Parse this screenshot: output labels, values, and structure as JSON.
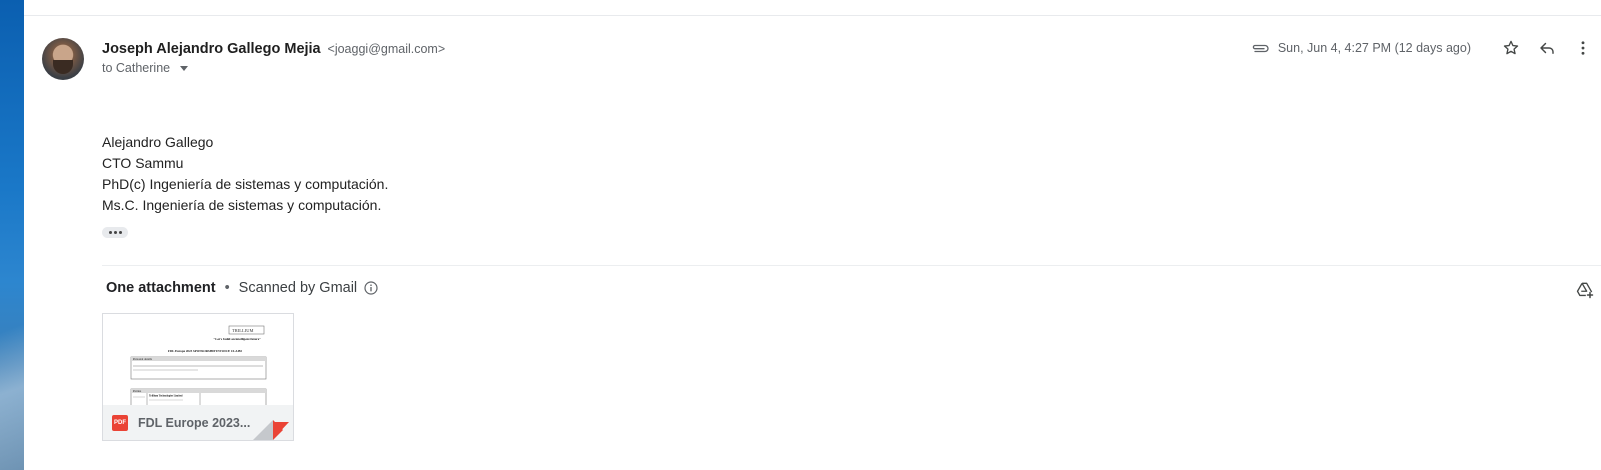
{
  "sender": {
    "name": "Joseph Alejandro Gallego Mejia",
    "email": "<joaggi@gmail.com>",
    "recipient": "to Catherine"
  },
  "meta": {
    "date": "Sun, Jun 4, 4:27 PM (12 days ago)"
  },
  "body_lines": [
    "Alejandro Gallego",
    "CTO Sammu",
    "PhD(c) Ingeniería de sistemas y computación.",
    "Ms.C. Ingeniería de sistemas y computación."
  ],
  "attachments": {
    "count_label": "One attachment",
    "separator": "•",
    "scanned_label": "Scanned by Gmail",
    "file": {
      "name": "FDL Europe 2023...",
      "type_label": "PDF",
      "preview": {
        "logo": "TRILLIUM",
        "tagline": "\"Let's build an intelligent future\"",
        "heading": "FDL Europe 2023 SPONSORSHIP INVOICE CLAIM",
        "section1": "Personal details",
        "section2": "Parties",
        "party": "Trillium Technologies Limited"
      }
    }
  },
  "icons": {
    "attachment": "paperclip-icon",
    "star": "star-icon",
    "reply": "reply-icon",
    "more": "more-vert-icon",
    "info": "info-icon",
    "drive": "add-to-drive-icon"
  },
  "colors": {
    "pdf": "#ea4335",
    "text": "#202124",
    "muted": "#5f6368"
  }
}
